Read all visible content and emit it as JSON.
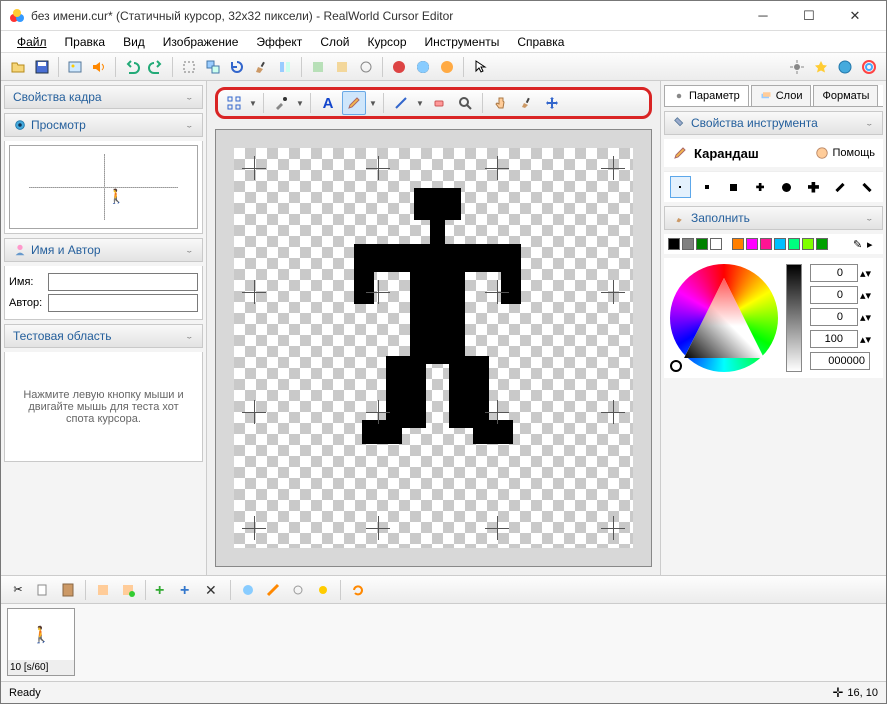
{
  "title": "без имени.cur* (Статичный курсор, 32x32 пиксели) - RealWorld Cursor Editor",
  "menu": [
    "Файл",
    "Правка",
    "Вид",
    "Изображение",
    "Эффект",
    "Слой",
    "Курсор",
    "Инструменты",
    "Справка"
  ],
  "left": {
    "frame_props": "Свойства кадра",
    "preview": "Просмотр",
    "name_author": "Имя и Автор",
    "name_label": "Имя:",
    "author_label": "Автор:",
    "name_value": "",
    "author_value": "",
    "test_area": "Тестовая область",
    "test_text": "Нажмите левую кнопку мыши и двигайте мышь для теста хот спота курсора."
  },
  "center_tools": [
    "select",
    "dropper",
    "text",
    "pencil",
    "line",
    "eraser",
    "fill",
    "finger",
    "brush",
    "move"
  ],
  "right": {
    "tabs": [
      "Параметр",
      "Слои",
      "Форматы"
    ],
    "tool_props": "Свойства инструмента",
    "tool_name": "Карандаш",
    "help": "Помощь",
    "fill": "Заполнить",
    "swatches": [
      "#000000",
      "#808080",
      "#00a000",
      "#ffffff",
      "#ffffff",
      "#ff7f00",
      "#ff00ff",
      "#ff1493",
      "#00bfff",
      "#00ff00",
      "#7fff00",
      "#00a000"
    ],
    "inputs": {
      "r": "0",
      "g": "0",
      "b": "0",
      "a": "100",
      "hex": "000000"
    }
  },
  "frame_time": "10 [s/60]",
  "status": "Ready",
  "coords": "16, 10"
}
